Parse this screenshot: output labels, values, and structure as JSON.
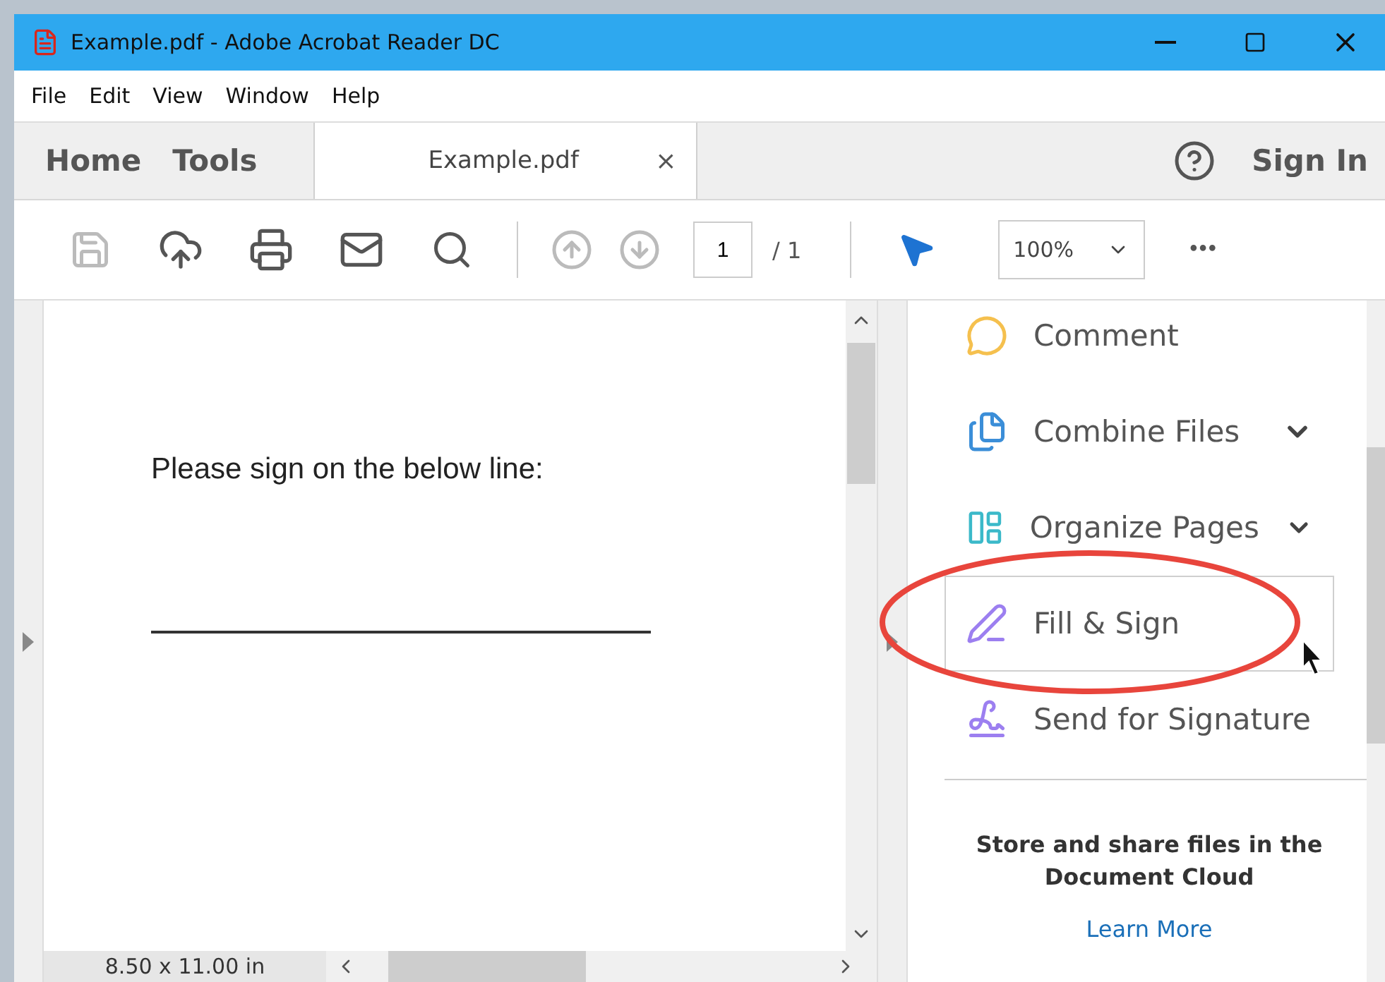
{
  "window": {
    "title": "Example.pdf - Adobe Acrobat Reader DC"
  },
  "menu": [
    "File",
    "Edit",
    "View",
    "Window",
    "Help"
  ],
  "tabs": [
    {
      "label": "Home",
      "kind": "nav",
      "selected": false
    },
    {
      "label": "Tools",
      "kind": "nav",
      "selected": false
    },
    {
      "label": "Example.pdf",
      "kind": "doc",
      "selected": true,
      "close": "×"
    }
  ],
  "sign_in": "Sign In",
  "toolbar": {
    "page": "1",
    "page_total": "/ 1",
    "zoom": "100%",
    "more": "•••"
  },
  "document": {
    "text": "Please sign on the below line:"
  },
  "status": "8.50 x 11.00 in",
  "tools": [
    {
      "label": "Comment",
      "kind": "comment",
      "expandable": false,
      "hovered": false
    },
    {
      "label": "Combine Files",
      "kind": "combine",
      "expandable": true,
      "hovered": false
    },
    {
      "label": "Organize Pages",
      "kind": "organize",
      "expandable": true,
      "hovered": false
    },
    {
      "label": "Fill & Sign",
      "kind": "fill",
      "expandable": false,
      "hovered": true
    },
    {
      "label": "Send for Signature",
      "kind": "send",
      "expandable": false,
      "hovered": false
    }
  ],
  "cloud": {
    "text": "Store and share files in the Document Cloud",
    "link": "Learn More"
  }
}
